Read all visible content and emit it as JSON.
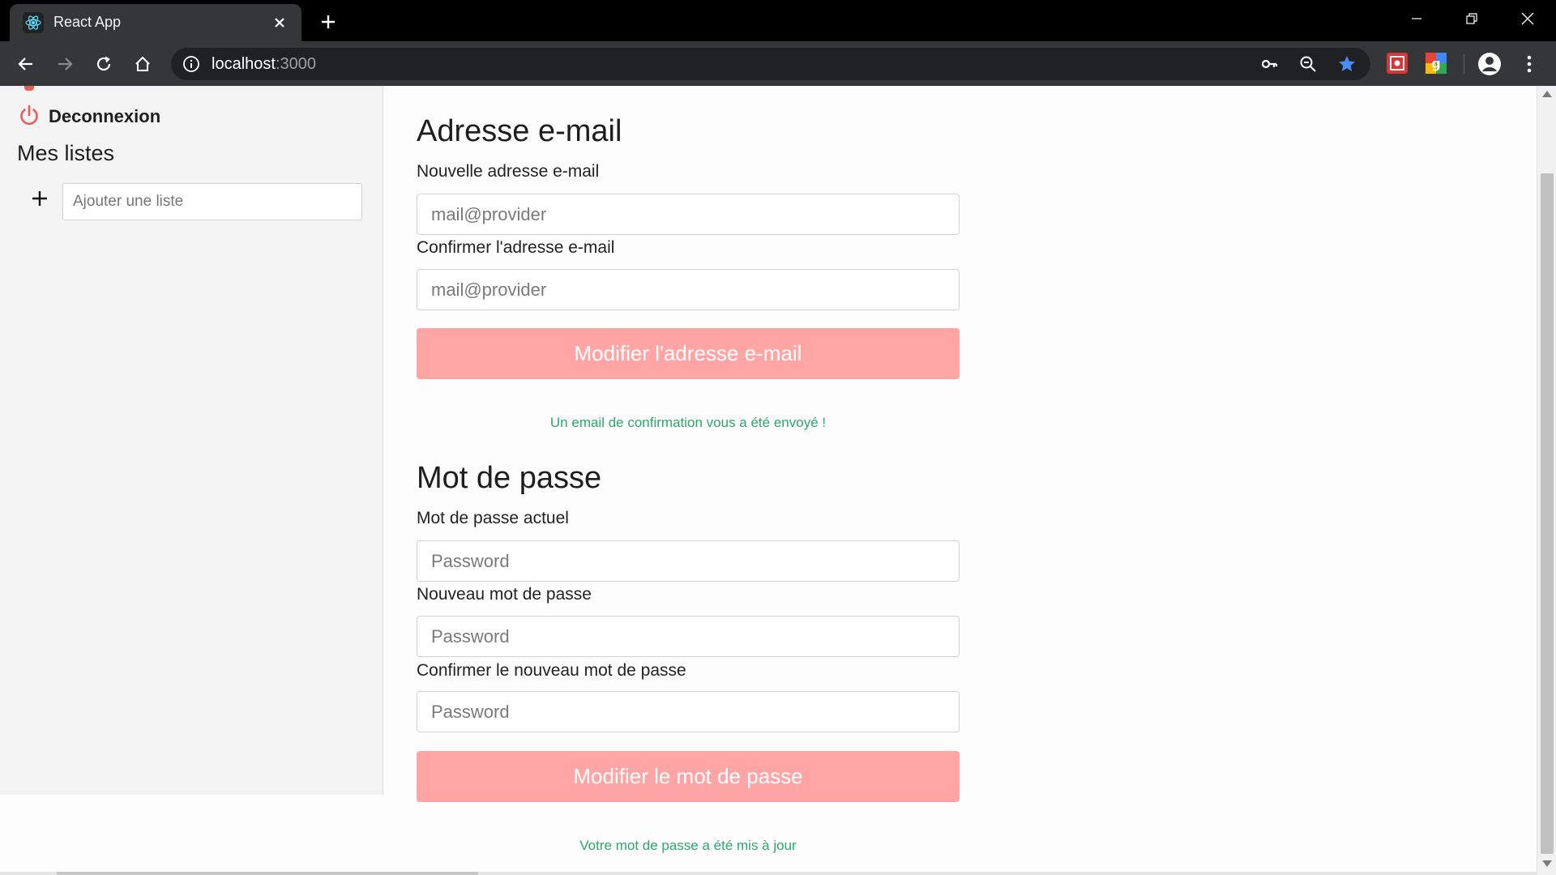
{
  "browser": {
    "tab_title": "React App",
    "url_host": "localhost",
    "url_port": ":3000"
  },
  "sidebar": {
    "logout_label": "Deconnexion",
    "lists_title": "Mes listes",
    "add_list_placeholder": "Ajouter une liste"
  },
  "email_section": {
    "title": "Adresse e-mail",
    "new_label": "Nouvelle adresse e-mail",
    "new_placeholder": "mail@provider",
    "confirm_label": "Confirmer l'adresse e-mail",
    "confirm_placeholder": "mail@provider",
    "submit_label": "Modifier l'adresse e-mail",
    "status_message": "Un email de confirmation vous a été envoyé !"
  },
  "password_section": {
    "title": "Mot de passe",
    "current_label": "Mot de passe actuel",
    "current_placeholder": "Password",
    "new_label": "Nouveau mot de passe",
    "new_placeholder": "Password",
    "confirm_label": "Confirmer le nouveau mot de passe",
    "confirm_placeholder": "Password",
    "submit_label": "Modifier le mot de passe",
    "status_message": "Votre mot de passe a été mis à jour"
  },
  "colors": {
    "button": "#ffa5a5",
    "success_text": "#2ca86a",
    "logout_icon": "#e0605a",
    "bookmark_star": "#4a8df8"
  },
  "icons": {
    "favicon": "react-logo-icon",
    "logout": "power-icon",
    "add_list": "plus-icon"
  }
}
